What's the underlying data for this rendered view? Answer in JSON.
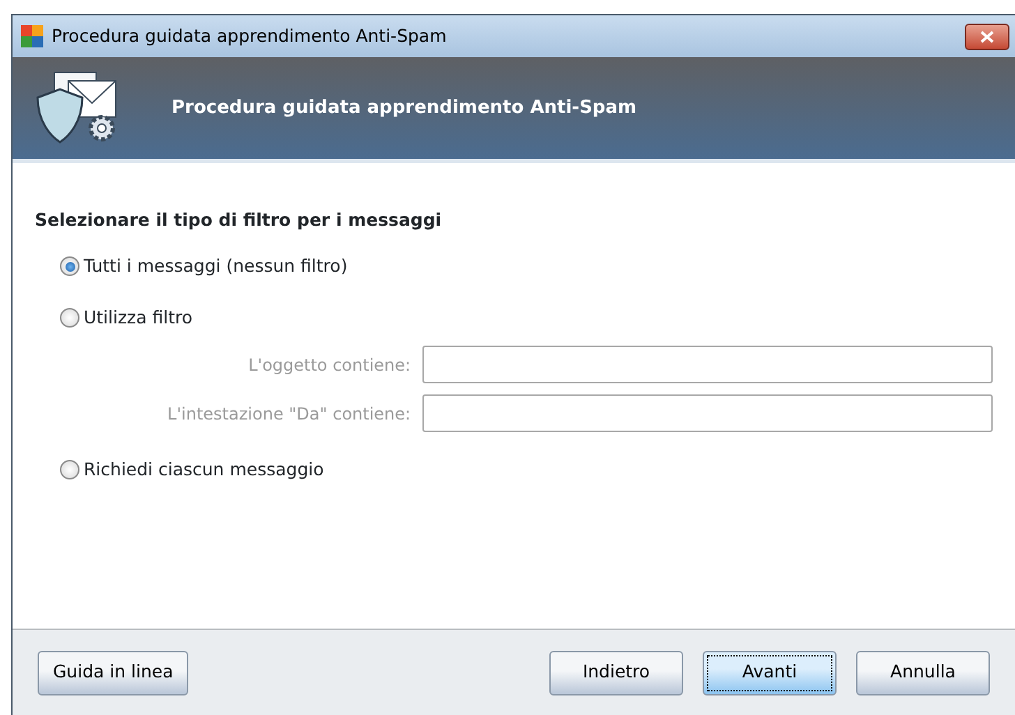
{
  "window": {
    "title": "Procedura guidata apprendimento Anti-Spam"
  },
  "header": {
    "title": "Procedura guidata apprendimento Anti-Spam"
  },
  "section_title": "Selezionare il tipo di filtro per i messaggi",
  "options": [
    {
      "label": "Tutti i messaggi (nessun filtro)",
      "selected": true
    },
    {
      "label": "Utilizza filtro",
      "selected": false,
      "fields": [
        {
          "label": "L'oggetto contiene:",
          "disabled": true
        },
        {
          "label": "L'intestazione \"Da\" contiene:",
          "disabled": true
        }
      ]
    },
    {
      "label": "Richiedi ciascun messaggio",
      "selected": false
    }
  ],
  "help_button": {
    "label": "Guida in linea",
    "focused": false
  },
  "nav_buttons": [
    {
      "label": "Indietro",
      "focused": false
    },
    {
      "label": "Avanti",
      "focused": true
    },
    {
      "label": "Annulla",
      "focused": false
    }
  ]
}
